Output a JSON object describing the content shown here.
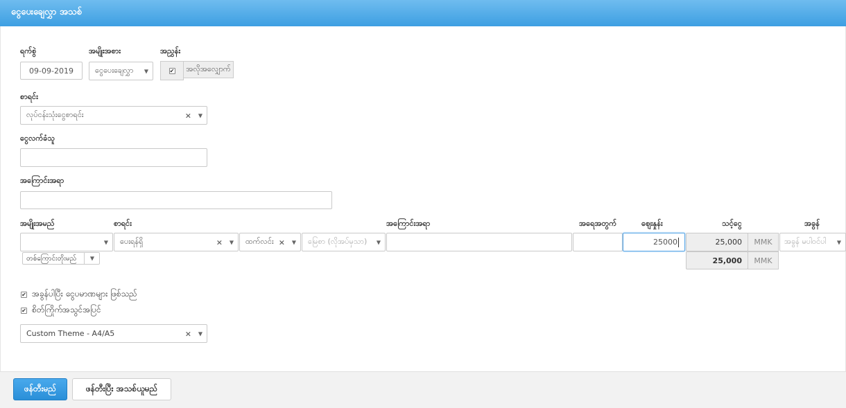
{
  "header": {
    "title": "ငွေပေးချေလွှာ အသစ်"
  },
  "form": {
    "date_label": "ရက်စွဲ",
    "date_value": "09-09-2019",
    "type_label": "အမျိုးအစား",
    "type_value": "ငွေပေးချေလွှာ",
    "approval_label": "အညွှန်း",
    "approval_text": "အလိုအလျှောက်",
    "account_label": "စာရင်း",
    "account_value": "လုပ်ငန်းသုံးငွေစာရင်း",
    "payee_label": "ငွေလက်ခံသူ",
    "payee_value": "",
    "desc_label": "အကြောင်းအရာ",
    "desc_value": ""
  },
  "table": {
    "headers": {
      "item": "အမျိုးအမည်",
      "account": "စာရင်း",
      "desc": "အကြောင်းအရာ",
      "qty": "အရေအတွက်",
      "price": "ဈေးနှုန်း",
      "amount": "သင့်ငွေ",
      "tax": "အခွန်"
    },
    "row": {
      "item": "",
      "account": "ပေးရန်ရှိ",
      "division": "ထက်လင်း",
      "location_placeholder": "မြေစာ (လိုအပ်မှသာ)",
      "desc": "",
      "qty": "",
      "price": "25000",
      "amount": "25,000",
      "currency": "MMK",
      "tax_placeholder": "အခွန် မပါဝင်ပါ"
    },
    "add_row_label": "တစ်ကြောင်းတိုးမည်",
    "total": "25,000",
    "total_currency": "MMK"
  },
  "options": {
    "tax_inclusive_label": "အခွန်ပါပြီး ငွေပမာဏများ ဖြစ်သည်",
    "print_label": "စိတ်ကြိုက်အသွင်အပြင်",
    "theme_value": "Custom Theme - A4/A5"
  },
  "footer": {
    "save_label": "ဖန်တီးမည်",
    "save_new_label": "ဖန်တီးပြီး အသစ်ယူမည်"
  }
}
